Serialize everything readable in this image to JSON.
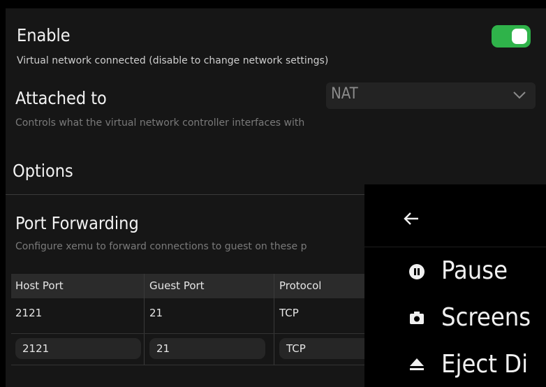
{
  "enable": {
    "title": "Enable",
    "description": "Virtual network connected (disable to change network settings)",
    "toggle_on": true
  },
  "attached": {
    "title": "Attached to",
    "description": "Controls what the virtual network controller interfaces with",
    "value": "NAT"
  },
  "options": {
    "title": "Options"
  },
  "port_forwarding": {
    "title": "Port Forwarding",
    "description": "Configure xemu to forward connections to guest on these p"
  },
  "table": {
    "headers": [
      "Host Port",
      "Guest Port",
      "Protocol"
    ],
    "rows": [
      [
        "2121",
        "21",
        "TCP"
      ]
    ],
    "new_row": {
      "host": "2121",
      "guest": "21",
      "protocol": "TCP"
    }
  },
  "menu": {
    "items": [
      {
        "label": "Pause",
        "icon": "pause-icon"
      },
      {
        "label": "Screens",
        "icon": "camera-icon"
      },
      {
        "label": "Eject Di",
        "icon": "eject-icon"
      }
    ]
  },
  "colors": {
    "toggle_on": "#2fb34a",
    "panel": "#161616",
    "menu_bg": "#000000"
  }
}
